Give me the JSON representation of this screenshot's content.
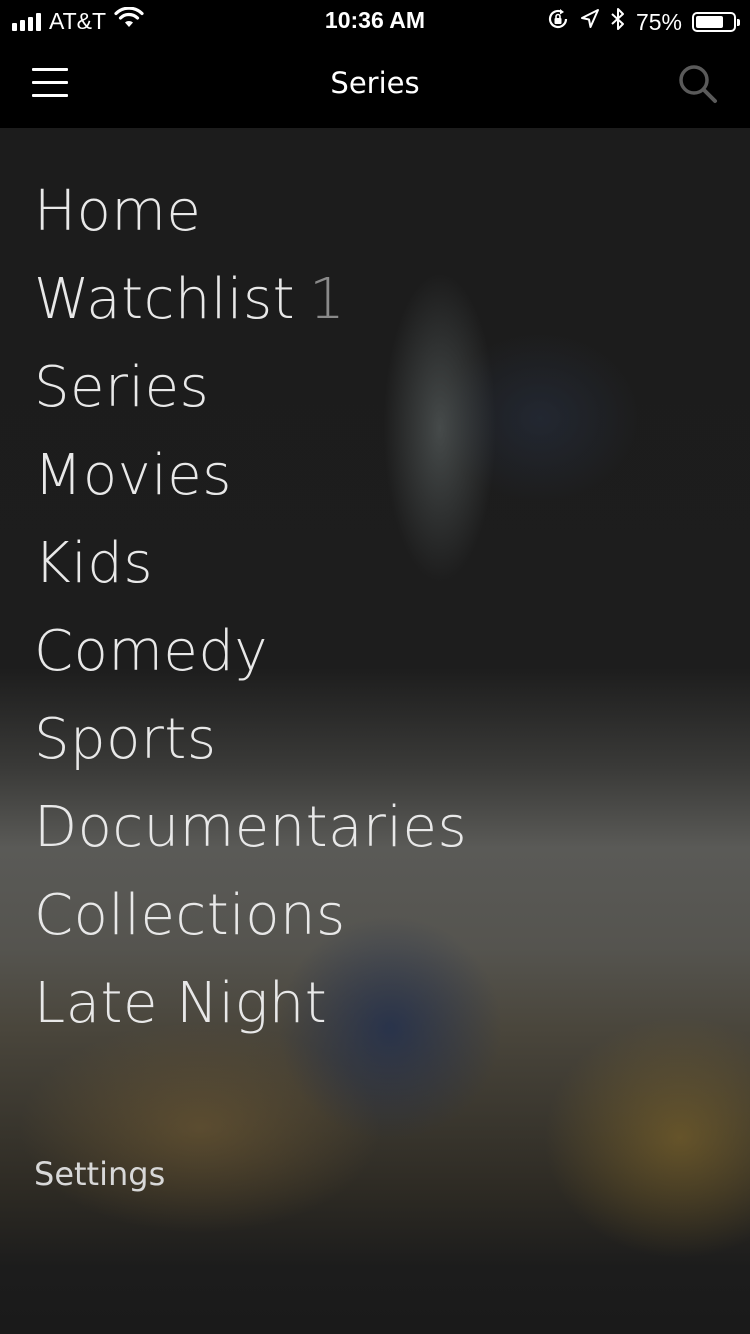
{
  "status_bar": {
    "carrier": "AT&T",
    "time": "10:36 AM",
    "battery_percent": "75%",
    "battery_level": 0.75,
    "icons": [
      "signal-icon",
      "wifi-icon",
      "orientation-lock-icon",
      "location-icon",
      "bluetooth-icon",
      "battery-icon"
    ]
  },
  "nav": {
    "title": "Series",
    "menu_icon": "hamburger-icon",
    "search_icon": "search-icon"
  },
  "menu": {
    "items": [
      {
        "label": "Home"
      },
      {
        "label": "Watchlist",
        "count": "1"
      },
      {
        "label": "Series"
      },
      {
        "label": "Movies"
      },
      {
        "label": "Kids"
      },
      {
        "label": "Comedy"
      },
      {
        "label": "Sports"
      },
      {
        "label": "Documentaries"
      },
      {
        "label": "Collections"
      },
      {
        "label": "Late Night"
      }
    ],
    "settings_label": "Settings"
  }
}
